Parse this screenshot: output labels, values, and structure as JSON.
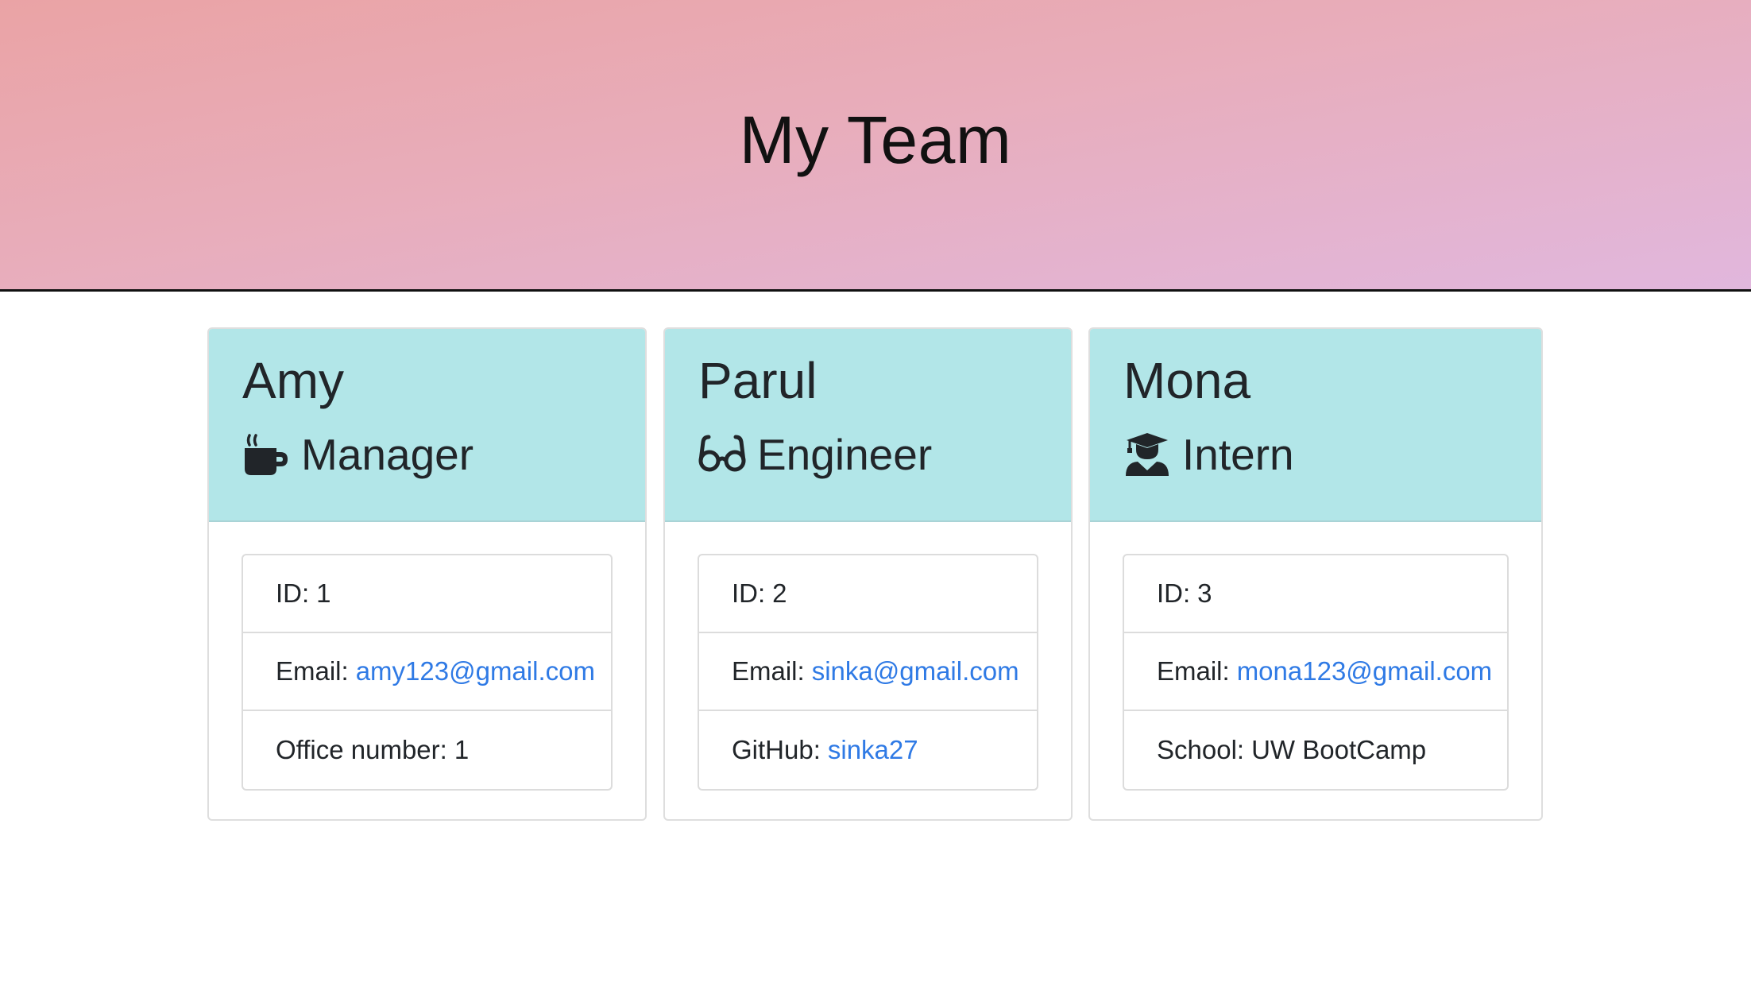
{
  "header": {
    "title": "My Team"
  },
  "colors": {
    "card_header_bg": "#b2e6e8",
    "link": "#2f7ae5",
    "jumbotron_gradient": [
      "#eaa3a5",
      "#e1b7dd"
    ]
  },
  "team": [
    {
      "name": "Amy",
      "role": "Manager",
      "icon": "coffee-mug-icon",
      "id_label": "ID:",
      "id_value": "1",
      "email_label": "Email:",
      "email": "amy123@gmail.com",
      "extra_label": "Office number:",
      "extra_value": "1"
    },
    {
      "name": "Parul",
      "role": "Engineer",
      "icon": "glasses-icon",
      "id_label": "ID:",
      "id_value": "2",
      "email_label": "Email:",
      "email": "sinka@gmail.com",
      "extra_label": "GitHub:",
      "extra_value": "sinka27"
    },
    {
      "name": "Mona",
      "role": "Intern",
      "icon": "graduate-icon",
      "id_label": "ID:",
      "id_value": "3",
      "email_label": "Email:",
      "email": "mona123@gmail.com",
      "extra_label": "School:",
      "extra_value": "UW BootCamp"
    }
  ]
}
